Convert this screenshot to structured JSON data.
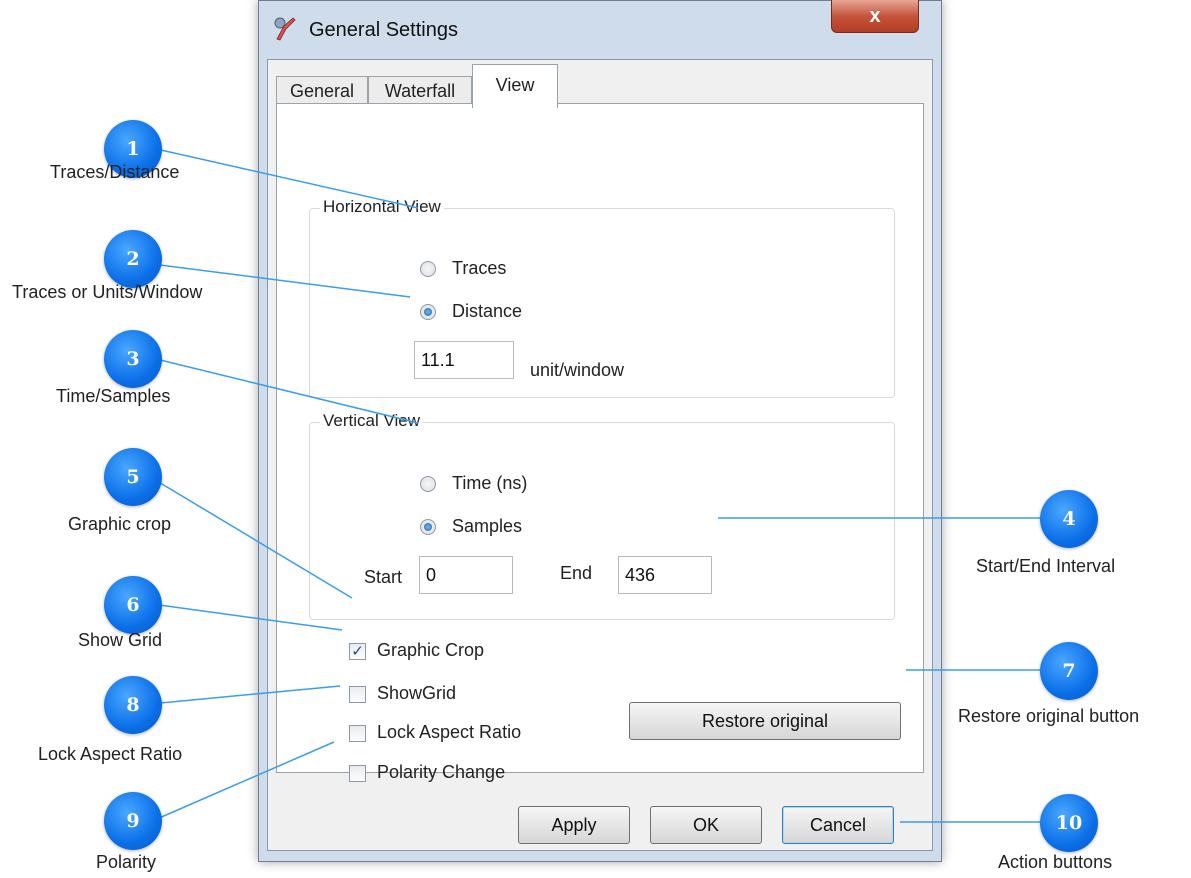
{
  "window": {
    "title": "General Settings",
    "close_label": "x"
  },
  "tabs": [
    {
      "label": "General"
    },
    {
      "label": "Waterfall"
    },
    {
      "label": "View"
    }
  ],
  "horizontal_view": {
    "title": "Horizontal View",
    "options": [
      {
        "label": "Traces",
        "checked": false
      },
      {
        "label": "Distance",
        "checked": true
      }
    ],
    "value": "11.1",
    "unit_label": "unit/window"
  },
  "vertical_view": {
    "title": "Vertical View",
    "options": [
      {
        "label": "Time (ns)",
        "checked": false
      },
      {
        "label": "Samples",
        "checked": true
      }
    ],
    "start_label": "Start",
    "start_value": "0",
    "end_label": "End",
    "end_value": "436"
  },
  "checkboxes": [
    {
      "label": "Graphic Crop",
      "checked": true
    },
    {
      "label": "ShowGrid",
      "checked": false
    },
    {
      "label": "Lock Aspect Ratio",
      "checked": false
    },
    {
      "label": "Polarity Change",
      "checked": false
    }
  ],
  "restore_label": "Restore original",
  "buttons": {
    "apply": "Apply",
    "ok": "OK",
    "cancel": "Cancel"
  },
  "annotations": [
    {
      "number": "1",
      "label": "Traces/Distance"
    },
    {
      "number": "2",
      "label": "Traces or Units/Window"
    },
    {
      "number": "3",
      "label": "Time/Samples"
    },
    {
      "number": "4",
      "label": "Start/End Interval"
    },
    {
      "number": "5",
      "label": "Graphic crop"
    },
    {
      "number": "6",
      "label": "Show Grid"
    },
    {
      "number": "7",
      "label": "Restore original button"
    },
    {
      "number": "8",
      "label": "Lock Aspect Ratio"
    },
    {
      "number": "9",
      "label": "Polarity"
    },
    {
      "number": "10",
      "label": "Action buttons"
    }
  ],
  "colors": {
    "bubble": "#0b6fe8",
    "callout_line": "#3a9ee8"
  }
}
